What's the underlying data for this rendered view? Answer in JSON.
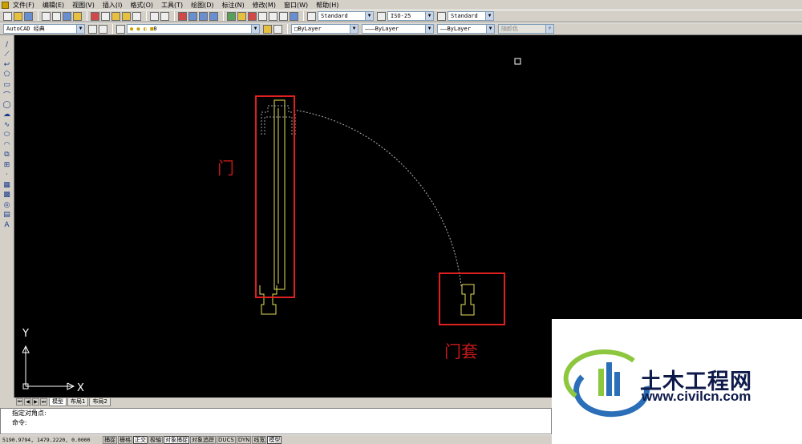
{
  "menu": [
    "文件(F)",
    "编辑(E)",
    "视图(V)",
    "插入(I)",
    "格式(O)",
    "工具(T)",
    "绘图(D)",
    "标注(N)",
    "修改(M)",
    "窗口(W)",
    "帮助(H)"
  ],
  "toolbar": {
    "text_style": "Standard",
    "dim_style": "ISO-25",
    "table_style": "Standard",
    "workspace": "AutoCAD 经典",
    "layer": "0",
    "color": "ByLayer",
    "linetype": "ByLayer",
    "lineweight": "ByLayer",
    "plotstyle": "随颜色"
  },
  "tabs": [
    "模型",
    "布局1",
    "布局2"
  ],
  "command": {
    "line1": "指定对角点:",
    "line2": "命令:"
  },
  "status": {
    "coords": "5190.9794, 1479.2220, 0.0000",
    "buttons": [
      "捕捉",
      "栅格",
      "正交",
      "极轴",
      "对象捕捉",
      "对象追踪",
      "DUCS",
      "DYN",
      "线宽",
      "模型"
    ]
  },
  "annotations": {
    "door": "门",
    "door_frame": "门套"
  },
  "ucs": {
    "x_label": "X",
    "y_label": "Y"
  },
  "watermark": {
    "name_cn": "土木工程网",
    "url": "www.civilcn.com"
  },
  "colors": {
    "canvas": "#000000",
    "geometry": "#e6e05a",
    "highlight": "#e02020",
    "arc": "#b0b0b0"
  }
}
